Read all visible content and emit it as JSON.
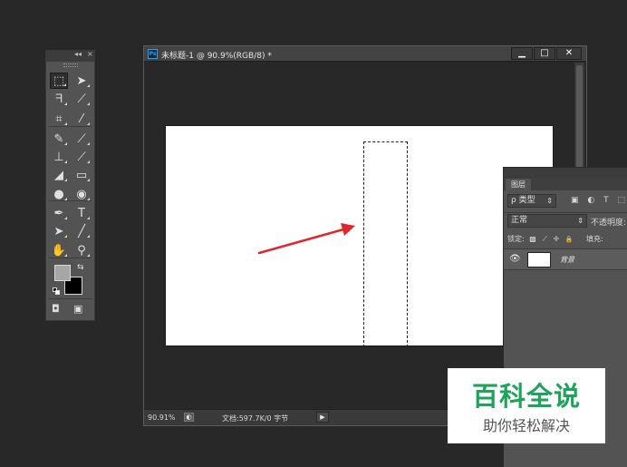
{
  "tools_panel": {
    "collapse_glyph": "◂◂",
    "close_glyph": "×",
    "tools": [
      {
        "name": "marquee-tool-icon",
        "glyph": "⬚",
        "active": true
      },
      {
        "name": "move-tool-icon",
        "glyph": "➤"
      },
      {
        "name": "lasso-tool-icon",
        "glyph": "ᖷ"
      },
      {
        "name": "quick-selection-tool-icon",
        "glyph": "⟋"
      },
      {
        "name": "crop-tool-icon",
        "glyph": "⌗"
      },
      {
        "name": "eyedropper-tool-icon",
        "glyph": "⁄"
      },
      {
        "name": "healing-brush-tool-icon",
        "glyph": "✎"
      },
      {
        "name": "brush-tool-icon",
        "glyph": "⟋"
      },
      {
        "name": "clone-stamp-tool-icon",
        "glyph": "⊥"
      },
      {
        "name": "history-brush-tool-icon",
        "glyph": "⟋"
      },
      {
        "name": "eraser-tool-icon",
        "glyph": "◢"
      },
      {
        "name": "gradient-tool-icon",
        "glyph": "▭"
      },
      {
        "name": "blur-tool-icon",
        "glyph": "●"
      },
      {
        "name": "dodge-tool-icon",
        "glyph": "◉"
      },
      {
        "name": "pen-tool-icon",
        "glyph": "✒"
      },
      {
        "name": "type-tool-icon",
        "glyph": "T"
      },
      {
        "name": "path-selection-tool-icon",
        "glyph": "➤"
      },
      {
        "name": "line-tool-icon",
        "glyph": "╱"
      },
      {
        "name": "hand-tool-icon",
        "glyph": "✋"
      },
      {
        "name": "zoom-tool-icon",
        "glyph": "⚲"
      }
    ],
    "foreground_color": "#a6a6a6",
    "background_color": "#000000",
    "swap_glyph": "⇆",
    "quick_mask_glyph": "◘",
    "screen_mode_glyph": "▣"
  },
  "document": {
    "title": "未标题-1 @ 90.9%(RGB/8) *",
    "app_icon_label": "Ps",
    "minimize_glyph": "▁",
    "maximize_glyph": "□",
    "close_glyph": "✕",
    "zoom": "90.91%",
    "status_icon_glyph": "◐",
    "doc_info": "文档:597.7K/0 字节",
    "status_arrow_glyph": "▶",
    "canvas_color": "#ffffff",
    "arrow_color": "#e0262f"
  },
  "layers_panel": {
    "tab_label": "图层",
    "filter_kind": "ρ 类型",
    "filter_arrow": "⇕",
    "filter_icons": [
      "▣",
      "◐",
      "T",
      "⬚"
    ],
    "blend_mode": "正常",
    "blend_arrow": "⇕",
    "opacity_label": "不透明度:",
    "lock_label": "锁定:",
    "lock_icons": [
      "▩",
      "⟋",
      "✛",
      "🔒"
    ],
    "fill_label": "填充:",
    "layer": {
      "name": "背景",
      "visible_glyph": "👁"
    }
  },
  "watermark": {
    "title": "百科全说",
    "subtitle": "助你轻松解决",
    "title_color": "#1ea35b"
  }
}
